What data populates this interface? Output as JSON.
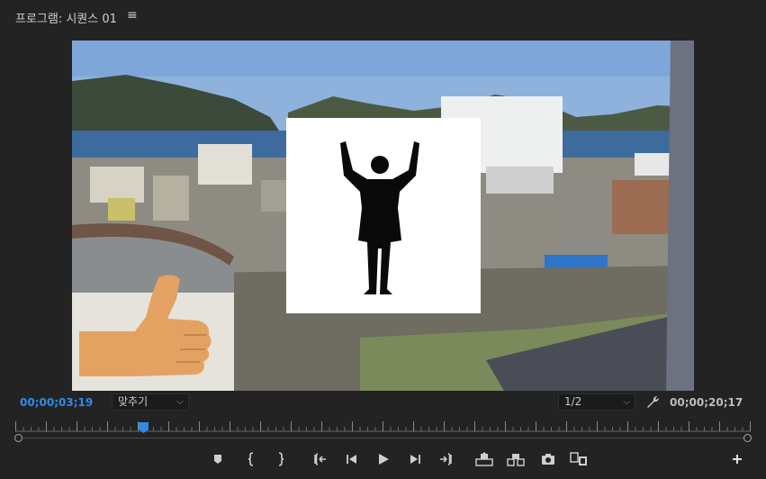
{
  "header": {
    "title": "프로그램: 시퀀스 01",
    "menu_icon": "hamburger-menu-icon"
  },
  "playback": {
    "current_timecode": "00;00;03;19",
    "duration_timecode": "00;00;20;17",
    "zoom_label": "맞추기",
    "resolution_label": "1/2",
    "playhead_position": 0.175
  },
  "controls": {
    "icons": [
      "add-marker-icon",
      "mark-in-icon",
      "mark-out-icon",
      "go-to-in-icon",
      "step-back-icon",
      "play-icon",
      "step-forward-icon",
      "go-to-out-icon",
      "lift-icon",
      "extract-icon",
      "export-frame-icon",
      "comparison-view-icon",
      "add-button-icon"
    ]
  },
  "colors": {
    "accent": "#2d8ceb",
    "background": "#232323"
  }
}
